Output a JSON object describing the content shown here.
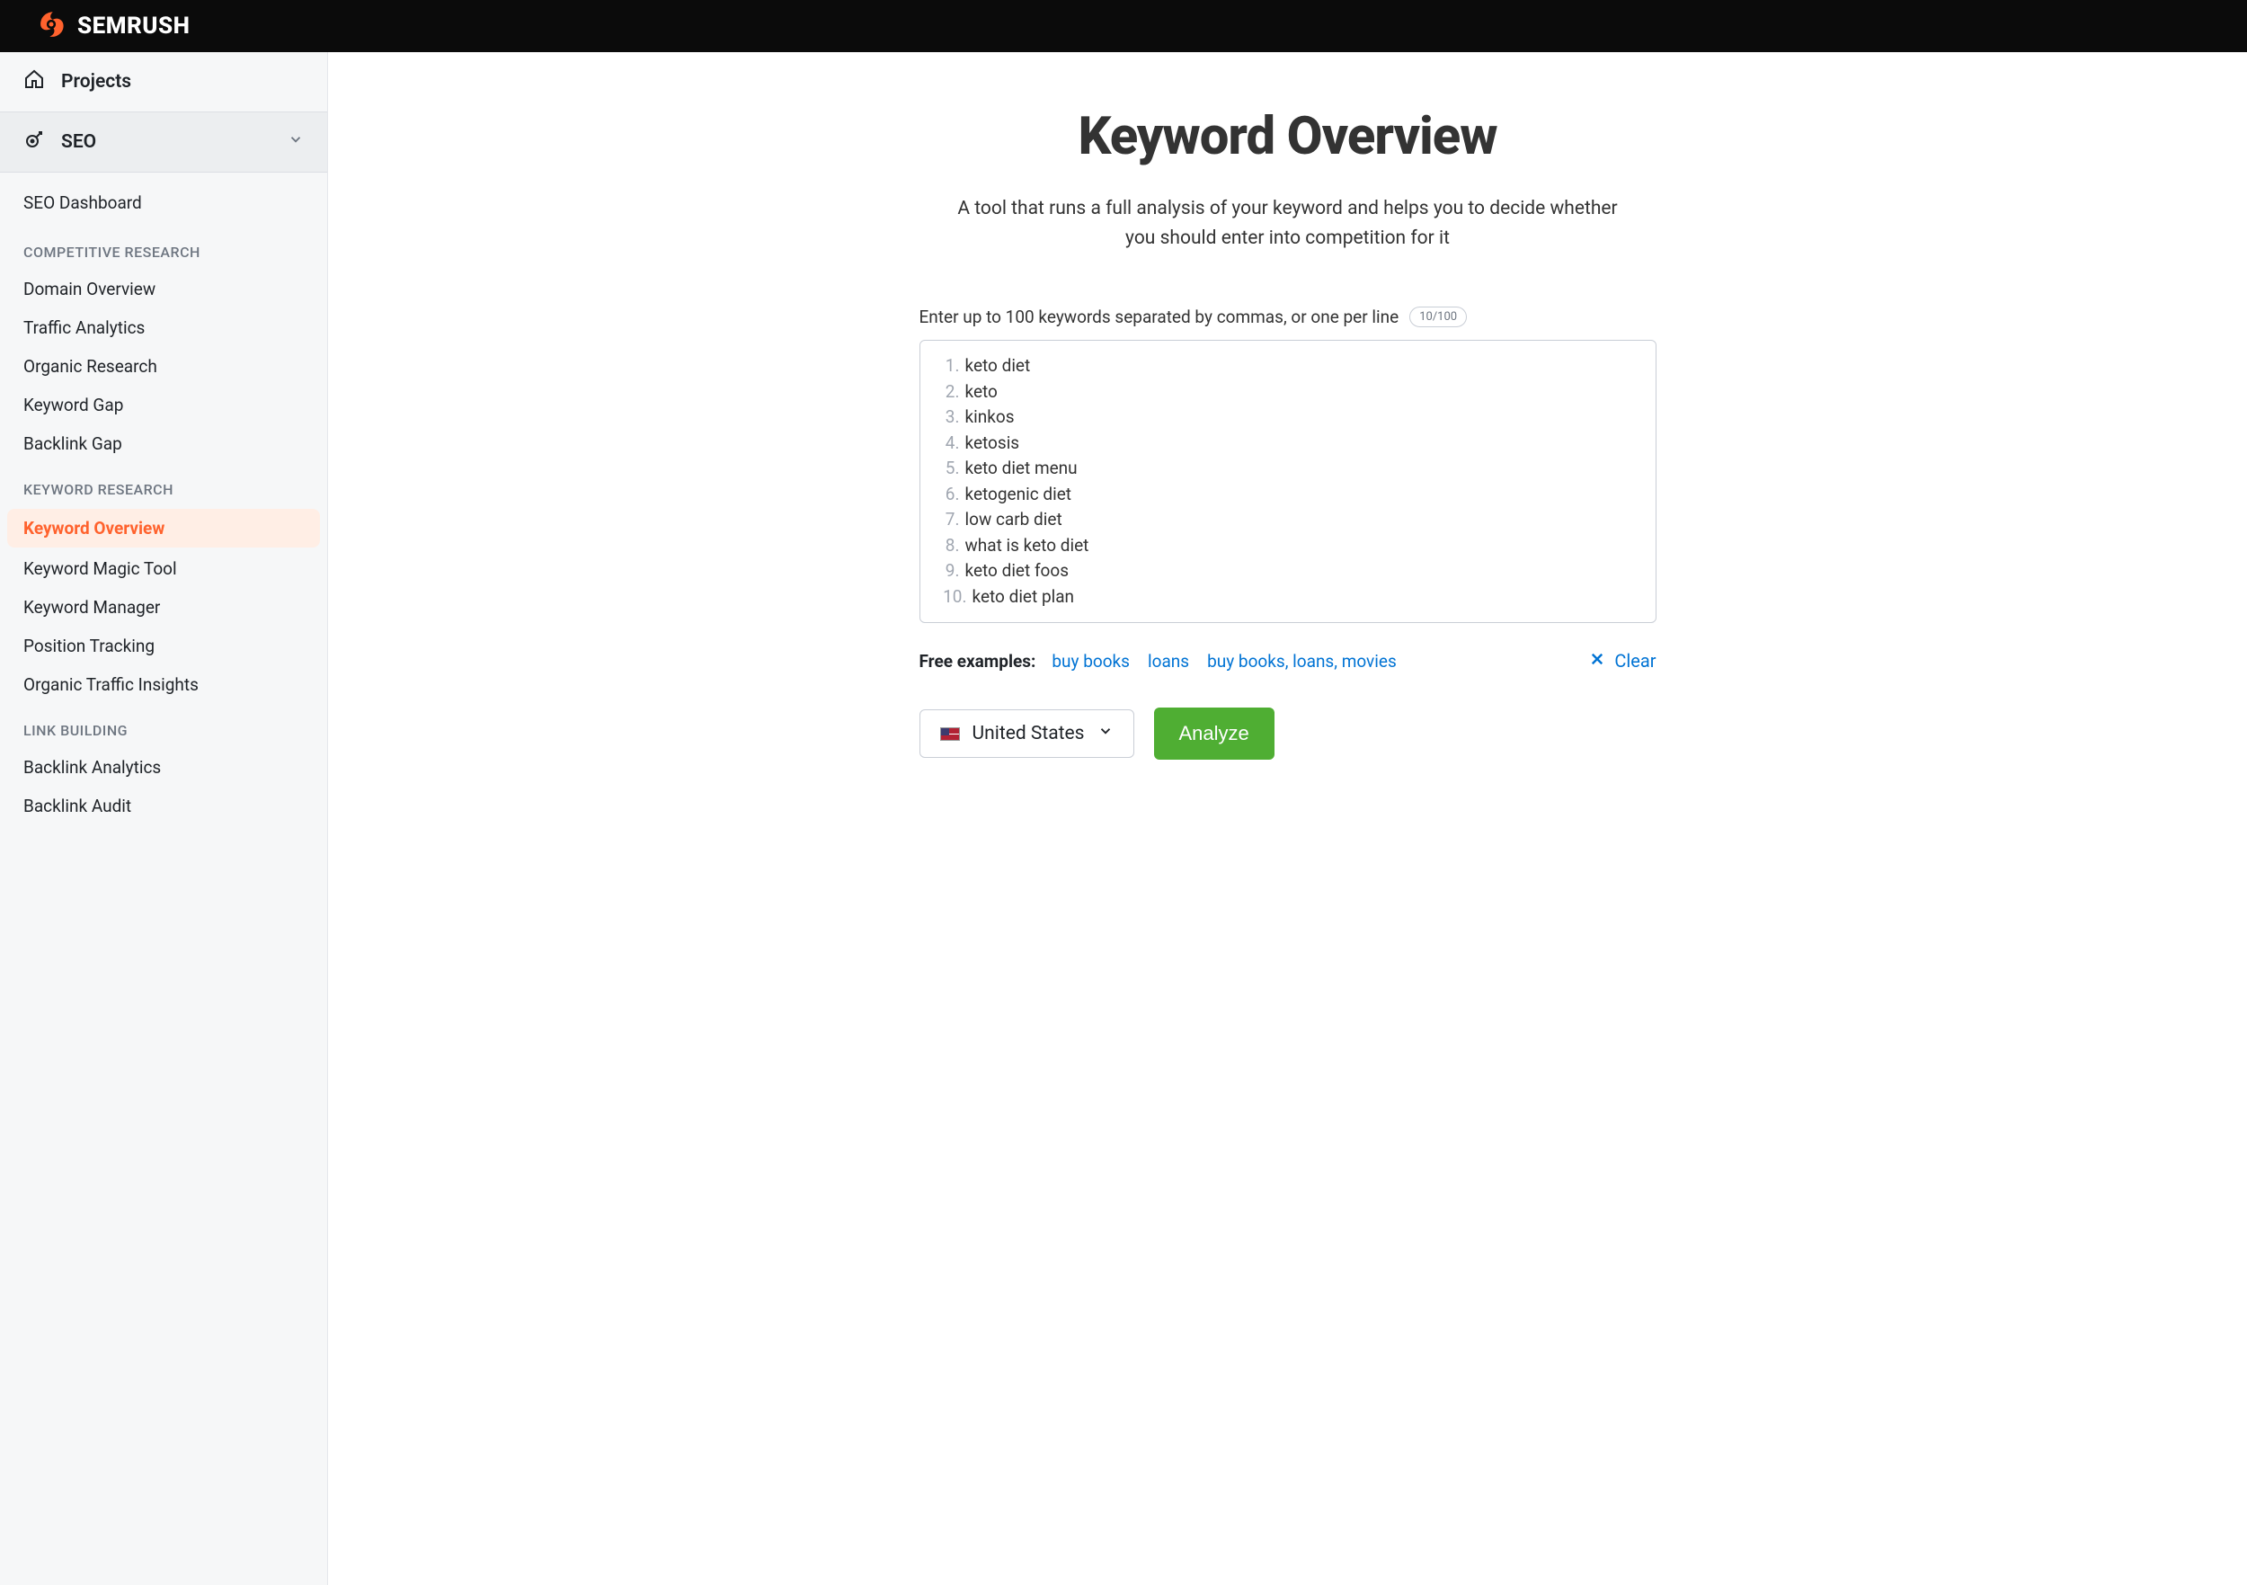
{
  "brand": {
    "name": "SEMRUSH"
  },
  "sidebar": {
    "projects_label": "Projects",
    "seo_label": "SEO",
    "dashboard_label": "SEO Dashboard",
    "groups": [
      {
        "label": "COMPETITIVE RESEARCH",
        "items": [
          {
            "label": "Domain Overview"
          },
          {
            "label": "Traffic Analytics"
          },
          {
            "label": "Organic Research"
          },
          {
            "label": "Keyword Gap"
          },
          {
            "label": "Backlink Gap"
          }
        ]
      },
      {
        "label": "KEYWORD RESEARCH",
        "items": [
          {
            "label": "Keyword Overview",
            "active": true
          },
          {
            "label": "Keyword Magic Tool"
          },
          {
            "label": "Keyword Manager"
          },
          {
            "label": "Position Tracking"
          },
          {
            "label": "Organic Traffic Insights"
          }
        ]
      },
      {
        "label": "LINK BUILDING",
        "items": [
          {
            "label": "Backlink Analytics"
          },
          {
            "label": "Backlink Audit"
          }
        ]
      }
    ]
  },
  "main": {
    "title": "Keyword Overview",
    "description": "A tool that runs a full analysis of your keyword and helps you to decide whether you should enter into competition for it",
    "input_label": "Enter up to 100 keywords separated by commas, or one per line",
    "count_badge": "10/100",
    "keywords": [
      "keto diet",
      "keto",
      "kinkos",
      "ketosis",
      "keto diet menu",
      "ketogenic diet",
      "low carb diet",
      "what is keto diet",
      "keto diet foos",
      "keto diet plan"
    ],
    "examples_label": "Free examples:",
    "examples": [
      "buy books",
      "loans",
      "buy books, loans, movies"
    ],
    "clear_label": "Clear",
    "country_label": "United States",
    "analyze_label": "Analyze"
  }
}
